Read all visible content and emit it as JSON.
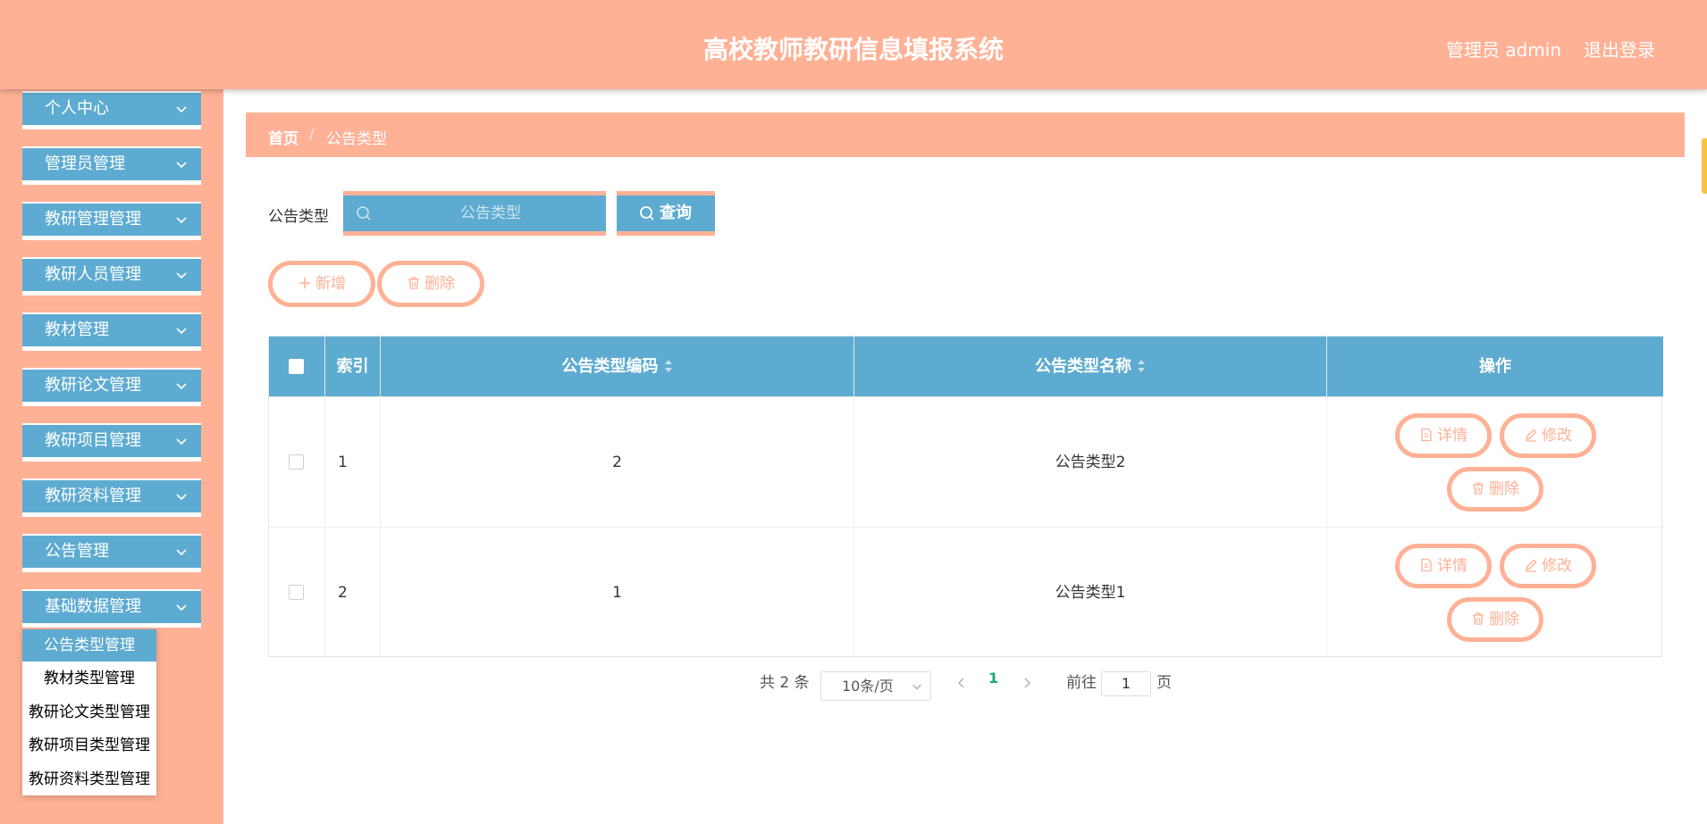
{
  "header": {
    "title": "高校教师教研信息填报系统",
    "user": "管理员 admin",
    "logout": "退出登录"
  },
  "sidebar": {
    "items": [
      {
        "label": "个人中心"
      },
      {
        "label": "管理员管理"
      },
      {
        "label": "教研管理管理"
      },
      {
        "label": "教研人员管理"
      },
      {
        "label": "教材管理"
      },
      {
        "label": "教研论文管理"
      },
      {
        "label": "教研项目管理"
      },
      {
        "label": "教研资料管理"
      },
      {
        "label": "公告管理"
      },
      {
        "label": "基础数据管理"
      }
    ],
    "submenu": [
      {
        "label": "公告类型管理",
        "active": true
      },
      {
        "label": "教材类型管理"
      },
      {
        "label": "教研论文类型管理"
      },
      {
        "label": "教研项目类型管理"
      },
      {
        "label": "教研资料类型管理"
      }
    ]
  },
  "breadcrumb": {
    "home": "首页",
    "separator": "/",
    "current": "公告类型"
  },
  "search": {
    "label": "公告类型",
    "placeholder": "公告类型",
    "value": "",
    "button": "查询"
  },
  "actions": {
    "add": "新增",
    "delete": "删除"
  },
  "table": {
    "headers": {
      "index": "索引",
      "code": "公告类型编码",
      "name": "公告类型名称",
      "ops": "操作"
    },
    "rows": [
      {
        "index": "1",
        "code": "2",
        "name": "公告类型2"
      },
      {
        "index": "2",
        "code": "1",
        "name": "公告类型1"
      }
    ],
    "row_buttons": {
      "detail": "详情",
      "edit": "修改",
      "delete": "删除"
    }
  },
  "pagination": {
    "total": "共 2 条",
    "page_size": "10条/页",
    "current_page": "1",
    "goto_label": "前往",
    "goto_value": "1",
    "page_suffix": "页"
  },
  "colors": {
    "primary": "#ffb196",
    "accent": "#5eabd1",
    "page_active": "#1aa97b"
  }
}
